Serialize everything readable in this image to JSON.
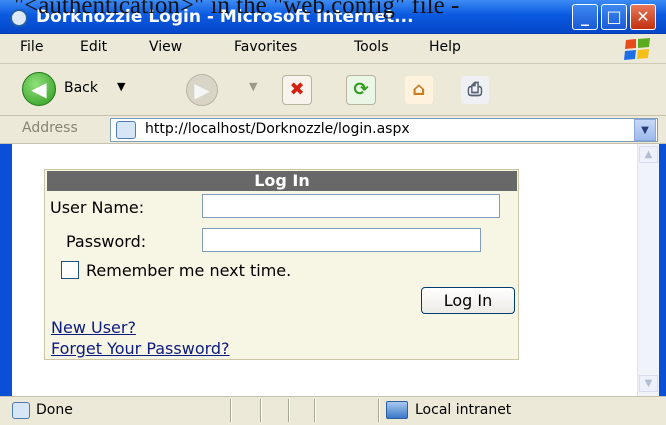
{
  "overlay_caption": "\"<authentication>\" in the \"web.config\" file -",
  "window": {
    "title": "Dorknozzle Login - Microsoft Internet..."
  },
  "menu": {
    "items": [
      "File",
      "Edit",
      "View",
      "Favorites",
      "Tools",
      "Help"
    ]
  },
  "toolbar": {
    "back_label": "Back",
    "icons": [
      "back-icon",
      "forward-icon",
      "stop-icon",
      "refresh-icon",
      "home-icon",
      "print-icon"
    ]
  },
  "address": {
    "label": "Address",
    "url": "http://localhost/Dorknozzle/login.aspx"
  },
  "login": {
    "header": "Log In",
    "username_label": "User Name:",
    "username_value": "",
    "password_label": "Password:",
    "password_value": "",
    "remember_label": "Remember me next time.",
    "remember_checked": false,
    "submit_label": "Log In",
    "new_user_link": "New User?",
    "forgot_link": "Forget Your Password?"
  },
  "statusbar": {
    "status": "Done",
    "zone": "Local intranet"
  },
  "colors": {
    "titlebar": "#0a5ae0",
    "chrome": "#ece9d8",
    "login_header": "#686868",
    "login_background": "#f7f5e3",
    "link": "#0b1b80"
  }
}
